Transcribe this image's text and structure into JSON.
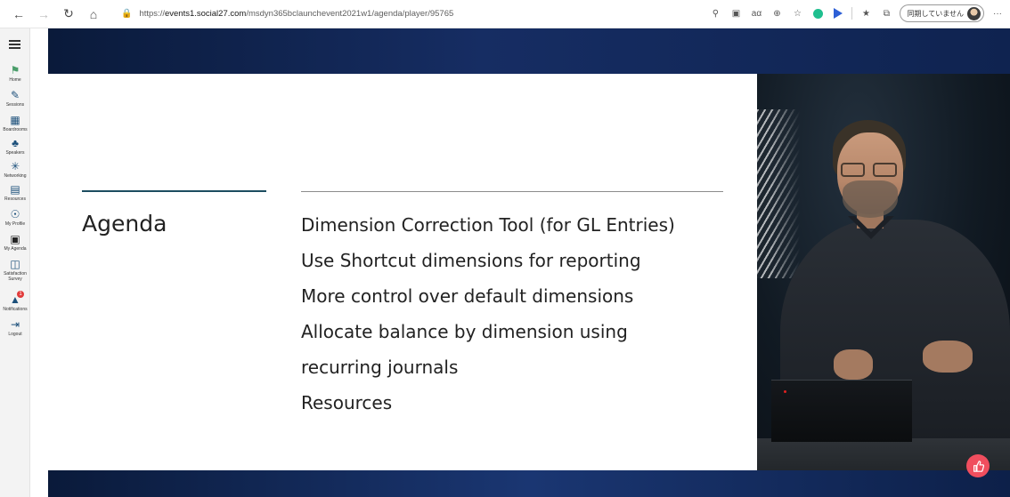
{
  "browser": {
    "url_prefix": "https://",
    "url_host": "events1.social27.com",
    "url_path": "/msdyn365bclaunchevent2021w1/agenda/player/95765",
    "profile_status": "同期していません",
    "more_label": "···"
  },
  "sidebar": {
    "items": [
      {
        "label": "Home",
        "icon": "home-icon"
      },
      {
        "label": "Sessions",
        "icon": "pencil-icon"
      },
      {
        "label": "Boardrooms",
        "icon": "boardroom-icon"
      },
      {
        "label": "Speakers",
        "icon": "speaker-icon"
      },
      {
        "label": "Networking",
        "icon": "network-icon"
      },
      {
        "label": "Resources",
        "icon": "resources-icon"
      },
      {
        "label": "My Profile",
        "icon": "profile-icon"
      },
      {
        "label": "My Agenda",
        "icon": "calendar-icon"
      },
      {
        "label": "Satisfaction Survey",
        "icon": "survey-icon"
      },
      {
        "label": "Notifications",
        "icon": "bell-icon",
        "badge": "1"
      },
      {
        "label": "Logout",
        "icon": "logout-icon"
      }
    ]
  },
  "slide": {
    "title": "Agenda",
    "items": [
      "Dimension Correction Tool (for GL Entries)",
      "Use Shortcut dimensions for reporting",
      "More control over default dimensions",
      "Allocate balance by dimension using",
      "recurring journals",
      "Resources"
    ]
  },
  "colors": {
    "accent_line": "#1c4d60",
    "stage_background": "#0b1c3d",
    "like_button": "#f04e5e",
    "notification_badge": "#e13b3b"
  }
}
